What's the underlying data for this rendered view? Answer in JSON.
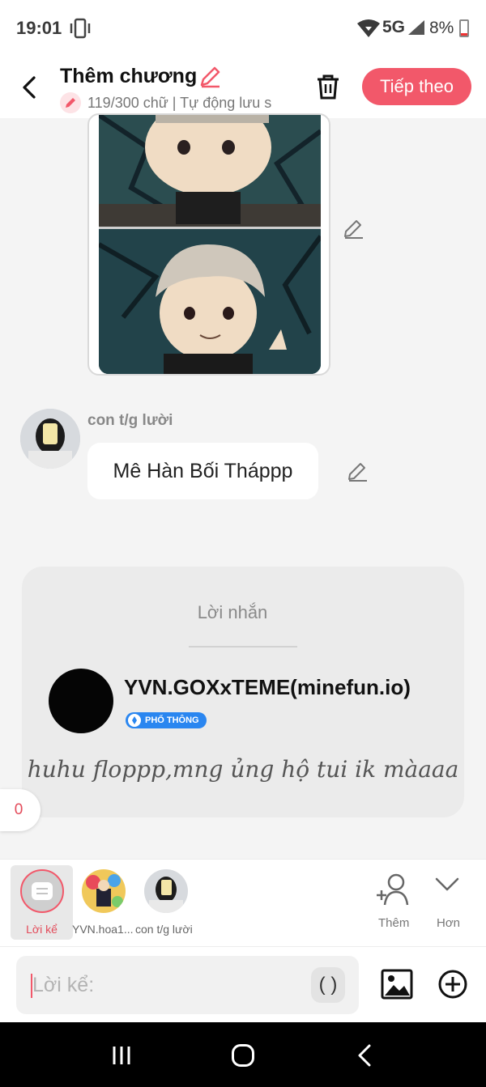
{
  "status_bar": {
    "time": "19:01",
    "network": "5G",
    "battery": "8%"
  },
  "header": {
    "title": "Thêm chương",
    "subtitle": "119/300 chữ | Tự động lưu s",
    "next_label": "Tiếp theo"
  },
  "dialogue": {
    "speaker": "con t/g lười",
    "text": "Mê Hàn Bối Tháppp"
  },
  "note": {
    "title": "Lời nhắn",
    "username": "YVN.GOXxTEME(minefun.io)",
    "tier": "PHỔ THÔNG",
    "message": "huhu floppp,mng ủng hộ tui ik màaaa"
  },
  "counter": "0",
  "characters": {
    "selected_label": "Lời kể",
    "items": [
      {
        "label": "YVN.hoa1..."
      },
      {
        "label": "con t/g lười"
      }
    ],
    "add_label": "Thêm",
    "more_label": "Hơn"
  },
  "input": {
    "placeholder": "Lời kể:",
    "paren": "( )"
  },
  "colors": {
    "accent": "#f2586a",
    "tier_badge": "#2a86f0"
  }
}
